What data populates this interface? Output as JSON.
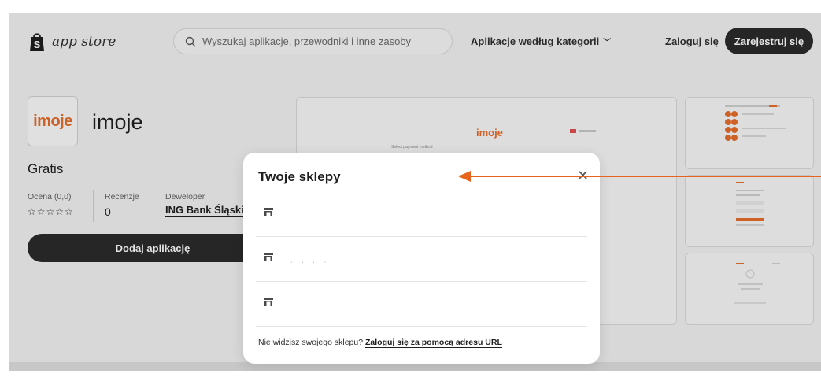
{
  "header": {
    "logo_text": "app store",
    "search_placeholder": "Wyszukaj aplikacje, przewodniki i inne zasoby",
    "categories_label": "Aplikacje według kategorii",
    "login_label": "Zaloguj się",
    "register_label": "Zarejestruj się"
  },
  "app": {
    "logo_text": "imoje",
    "name": "imoje",
    "price": "Gratis",
    "rating_label": "Ocena (0,0)",
    "rating_stars": "☆☆☆☆☆",
    "reviews_label": "Recenzje",
    "reviews_count": "0",
    "developer_label": "Deweloper",
    "developer_name": "ING Bank Śląski",
    "add_button": "Dodaj aplikację"
  },
  "screenshots": {
    "main_brand": "imoje",
    "main_caption": "Select payment method"
  },
  "modal": {
    "title": "Twoje sklepy",
    "close_glyph": "✕",
    "shops": [
      {
        "name": ""
      },
      {
        "name": "· · · ·"
      },
      {
        "name": ""
      }
    ],
    "footer_text": "Nie widzisz swojego sklepu?",
    "footer_link": "Zaloguj się za pomocą adresu URL"
  },
  "colors": {
    "accent_orange": "#e56d2b",
    "dark_button": "#2b2b2b",
    "annotation_arrow": "#e8641b"
  }
}
